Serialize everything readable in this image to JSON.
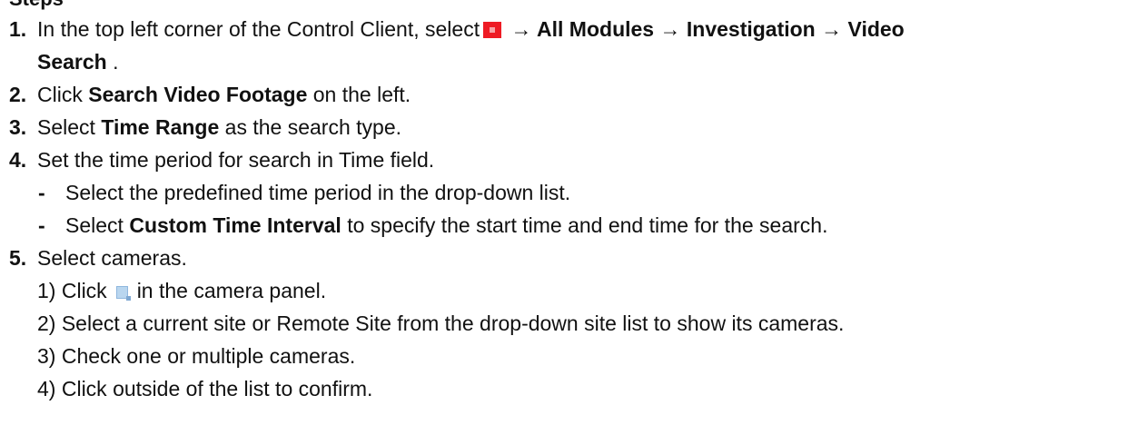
{
  "heading": "Steps",
  "steps": [
    {
      "num": "1.",
      "text_a": "In the top left corner of the Control Client, select",
      "icon": "red-menu-icon",
      "arrow_1": " → ",
      "bold_1": "All Modules",
      "arrow_2": " → ",
      "bold_2": "Investigation",
      "arrow_3": " → ",
      "bold_3": "Video",
      "bold_3_cont": "Search",
      "text_end": " ."
    },
    {
      "num": "2.",
      "text_a": "Click ",
      "bold_1": "Search Video Footage",
      "text_b": " on the left."
    },
    {
      "num": "3.",
      "text_a": "Select ",
      "bold_1": "Time Range",
      "text_b": " as the search type."
    },
    {
      "num": "4.",
      "text_a": "Set the time period for search in Time field.",
      "bullets": [
        {
          "dash": "-",
          "text_a": "Select the predefined time period in the drop-down list."
        },
        {
          "dash": "-",
          "text_a": "Select ",
          "bold_1": "Custom Time Interval",
          "text_b": " to specify the start time and end time for the search."
        }
      ]
    },
    {
      "num": "5.",
      "text_a": "Select cameras.",
      "substeps": [
        {
          "num": "1)",
          "text_a": " Click",
          "icon": "camera-select-icon",
          "text_b": "in the camera panel."
        },
        {
          "num": "2)",
          "text_a": " Select a current site or Remote Site from the drop-down site list to show its cameras."
        },
        {
          "num": "3)",
          "text_a": " Check one or multiple cameras."
        },
        {
          "num": "4)",
          "text_a": " Click outside of the list to confirm."
        }
      ]
    }
  ]
}
